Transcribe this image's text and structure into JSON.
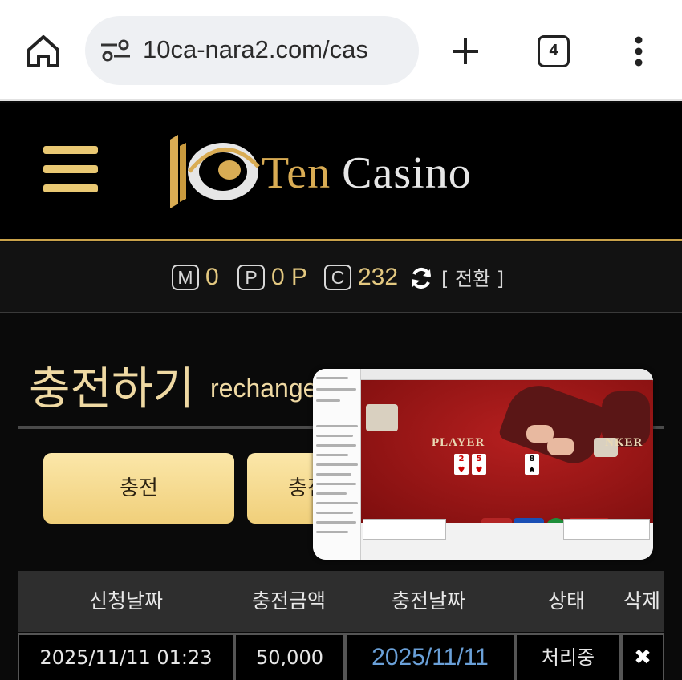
{
  "browser": {
    "url": "10ca-nara2.com/cas",
    "tab_count": "4"
  },
  "site": {
    "logo_ten": "Ten",
    "logo_casino": "Casino",
    "colors": {
      "gold": "#e9c873",
      "cream": "#efd9a3",
      "link_blue": "#6aa0d8"
    }
  },
  "points": {
    "m_badge": "M",
    "m_value": "0",
    "p_badge": "P",
    "p_value": "0 P",
    "c_badge": "C",
    "c_value": "232",
    "switch_label": "[ 전환 ]"
  },
  "page": {
    "title": "충전하기",
    "subtitle": "rechange"
  },
  "buttons": {
    "charge": "충전",
    "history": "충전"
  },
  "video": {
    "player_label": "PLAYER",
    "banker_label": "NKER"
  },
  "table": {
    "headers": [
      "신청날짜",
      "충전금액",
      "충전날짜",
      "상태",
      "삭제"
    ],
    "rows": [
      {
        "request_date": "2025/11/11 01:23",
        "amount": "50,000",
        "charge_date": "2025/11/11",
        "status": "처리중",
        "delete": "✖"
      }
    ]
  }
}
